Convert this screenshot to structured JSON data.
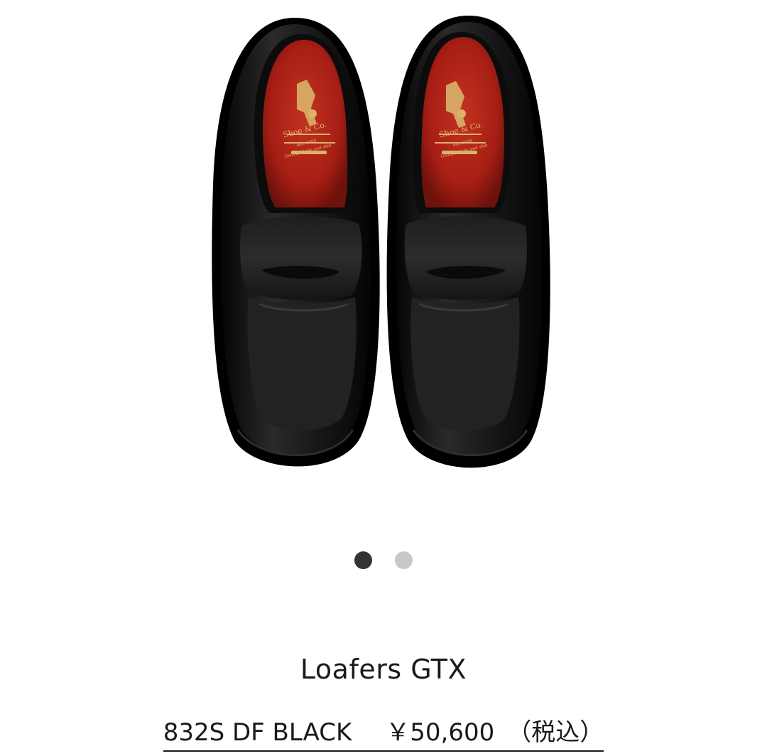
{
  "product": {
    "name": "Loafers GTX",
    "model": "832S DF BLACK",
    "price": "￥50,600",
    "tax_note": "（税込）"
  },
  "insole": {
    "brand": "Shoe & Co.",
    "est": "est. 1880",
    "tagline": "Genuine hide and skin"
  },
  "carousel": {
    "total": 2,
    "active_index": 0
  },
  "colors": {
    "leather": "#151515",
    "insole_red": "#b8261c",
    "gold": "#d9b36a",
    "dot_active": "#333333",
    "dot_inactive": "#c8c8c8"
  }
}
